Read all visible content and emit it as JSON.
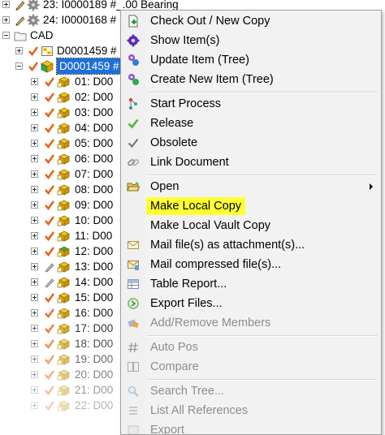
{
  "tree": {
    "top_items": [
      {
        "label": "23: I0000189 #_.00 Bearing"
      },
      {
        "label": "24: I0000168 #"
      }
    ],
    "folder": {
      "label": "CAD"
    },
    "doc_item": {
      "label": "D0001459 #"
    },
    "selected_item": {
      "label": "D0001459 #"
    },
    "children": [
      {
        "label": "01: D00"
      },
      {
        "label": "02: D00"
      },
      {
        "label": "03: D00"
      },
      {
        "label": "04: D00"
      },
      {
        "label": "05: D00"
      },
      {
        "label": "06: D00"
      },
      {
        "label": "07: D00"
      },
      {
        "label": "08: D00"
      },
      {
        "label": "09: D00"
      },
      {
        "label": "10: D00"
      },
      {
        "label": "11: D00"
      },
      {
        "label": "12: D00"
      },
      {
        "label": "13: D00"
      },
      {
        "label": "14: D00"
      },
      {
        "label": "15: D00"
      },
      {
        "label": "16: D00"
      },
      {
        "label": "17: D00"
      },
      {
        "label": "18: D00"
      },
      {
        "label": "19: D00"
      },
      {
        "label": "20: D00"
      },
      {
        "label": "21: D00"
      },
      {
        "label": "22: D00"
      }
    ]
  },
  "menu": {
    "items": [
      {
        "label": "Check Out / New Copy",
        "icon": "checkout-icon"
      },
      {
        "label": "Show Item(s)",
        "icon": "show-items-icon"
      },
      {
        "label": "Update Item (Tree)",
        "icon": "update-tree-icon"
      },
      {
        "label": "Create New Item (Tree)",
        "icon": "create-tree-icon"
      },
      {
        "label": "Start Process",
        "icon": "process-icon"
      },
      {
        "label": "Release",
        "icon": "green-check-icon"
      },
      {
        "label": "Obsolete",
        "icon": "gray-check-icon"
      },
      {
        "label": "Link Document",
        "icon": "link-icon"
      },
      {
        "label": "Open",
        "icon": "folder-open-icon"
      },
      {
        "label": "Make Local Copy"
      },
      {
        "label": "Make Local Vault Copy"
      },
      {
        "label": "Mail file(s) as attachment(s)...",
        "icon": "mail-icon"
      },
      {
        "label": "Mail compressed file(s)...",
        "icon": "mail-zip-icon"
      },
      {
        "label": "Table Report...",
        "icon": "table-icon"
      },
      {
        "label": "Export Files...",
        "icon": "export-icon"
      },
      {
        "label": "Add/Remove Members",
        "icon": "members-icon"
      },
      {
        "label": "Auto Pos",
        "icon": "hash-icon"
      },
      {
        "label": "Compare",
        "icon": "compare-icon"
      },
      {
        "label": "Search Tree...",
        "icon": "search-icon"
      },
      {
        "label": "List All References",
        "icon": "references-icon"
      },
      {
        "label": "Export",
        "icon": "export2-icon"
      }
    ],
    "highlight_color": "#ffff33"
  }
}
